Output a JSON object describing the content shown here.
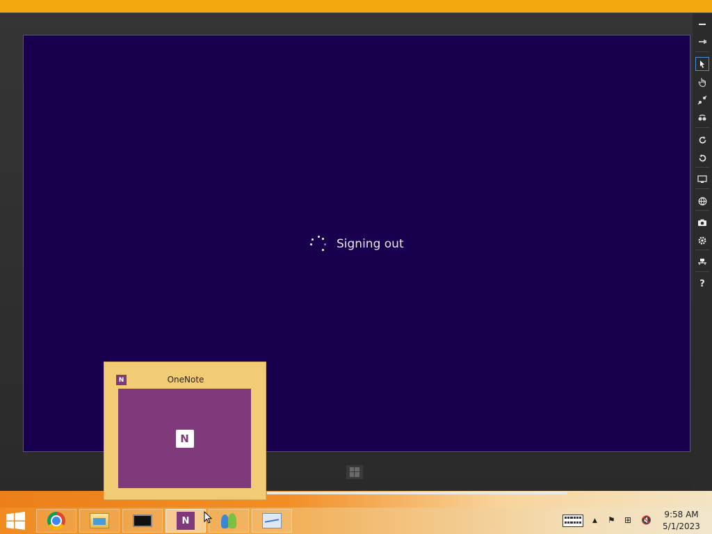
{
  "screen": {
    "status_text": "Signing out",
    "background_color": "#18004f"
  },
  "simulator_toolbar": {
    "buttons": [
      {
        "name": "minimize-icon",
        "glyph": "▬"
      },
      {
        "name": "pin-icon",
        "glyph": "⊣"
      },
      {
        "name": "mouse-mode-icon",
        "glyph": "➤"
      },
      {
        "name": "touch-mode-icon",
        "glyph": "✋"
      },
      {
        "name": "pinch-zoom-icon",
        "glyph": "⤡"
      },
      {
        "name": "rotation-touch-icon",
        "glyph": "↻"
      },
      {
        "name": "rotate-clockwise-icon",
        "glyph": "↻"
      },
      {
        "name": "rotate-counterclockwise-icon",
        "glyph": "↺"
      },
      {
        "name": "resolution-icon",
        "glyph": "▭"
      },
      {
        "name": "location-icon",
        "glyph": "⊕"
      },
      {
        "name": "screenshot-icon",
        "glyph": "◉"
      },
      {
        "name": "settings-icon",
        "glyph": "⚙"
      },
      {
        "name": "network-icon",
        "glyph": "╪"
      },
      {
        "name": "help-icon",
        "glyph": "?"
      }
    ]
  },
  "thumbnail_popup": {
    "title": "OneNote",
    "icon_letter": "N"
  },
  "taskbar": {
    "apps": [
      {
        "name": "chrome",
        "active": false
      },
      {
        "name": "file-explorer",
        "active": false
      },
      {
        "name": "simulator",
        "active": false
      },
      {
        "name": "onenote",
        "active": true,
        "icon_letter": "N"
      },
      {
        "name": "live-messenger",
        "active": false
      },
      {
        "name": "performance-monitor",
        "active": false
      }
    ],
    "tray": {
      "show_hidden_glyph": "▲",
      "action_center_glyph": "⚑",
      "network_glyph": "⊞",
      "volume_glyph": "🔇"
    },
    "clock": {
      "time": "9:58 AM",
      "date": "5/1/2023"
    }
  },
  "colors": {
    "taskbar_accent": "#f3a90e",
    "onenote_purple": "#80397b"
  }
}
